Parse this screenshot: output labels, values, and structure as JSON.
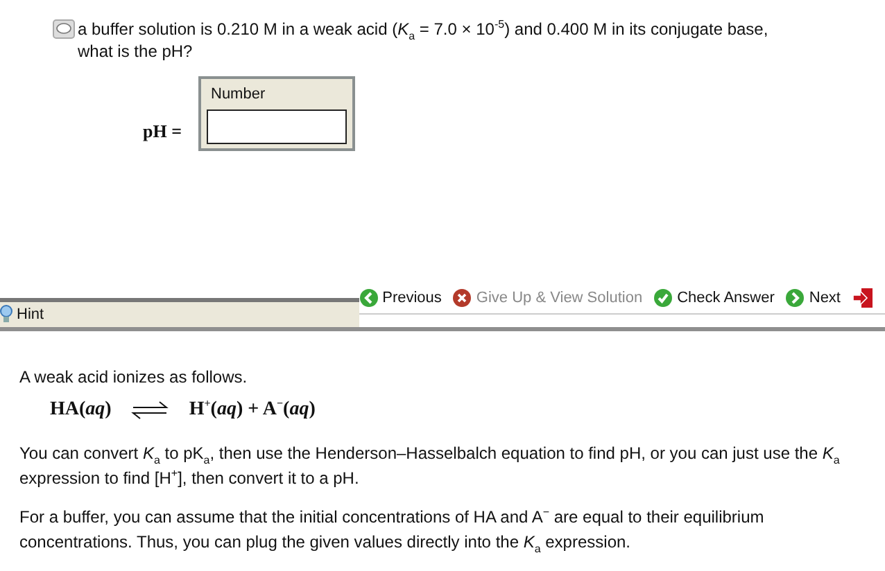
{
  "question": {
    "text": "a buffer solution is 0.210 M in a weak acid (*K*$_{a}$ = 7.0 × 10$^{-5}$) and 0.400 M in its conjugate base, what is the pH?"
  },
  "answer": {
    "label": "pH =",
    "field_title": "Number"
  },
  "hint_tab": {
    "label": "Hint"
  },
  "actions": [
    {
      "kind": "previous",
      "label": "Previous",
      "disabled": false
    },
    {
      "kind": "giveup",
      "label": "Give Up & View Solution",
      "disabled": true
    },
    {
      "kind": "check",
      "label": "Check Answer",
      "disabled": false
    },
    {
      "kind": "next",
      "label": "Next",
      "disabled": false
    },
    {
      "kind": "exit"
    }
  ],
  "hint": {
    "intro": "A weak acid ionizes as follows.",
    "equation": {
      "reactant": "HA(*aq*)",
      "product": "H$^{+}$(*aq*) + A$^{−}$(*aq*)"
    },
    "paragraphs": [
      "You can convert *K*$_{a}$ to pK$_{a}$, then use the Henderson–Hasselbalch equation to find pH, or you can just use the *K*$_{a}$ expression to find [H$^{+}$], then convert it to a pH.",
      "For a buffer, you can assume that the initial concentrations of HA and A$^{−}$ are equal to their equilibrium concentrations. Thus, you can plug the given values directly into the *K*$_{a}$ expression."
    ]
  }
}
